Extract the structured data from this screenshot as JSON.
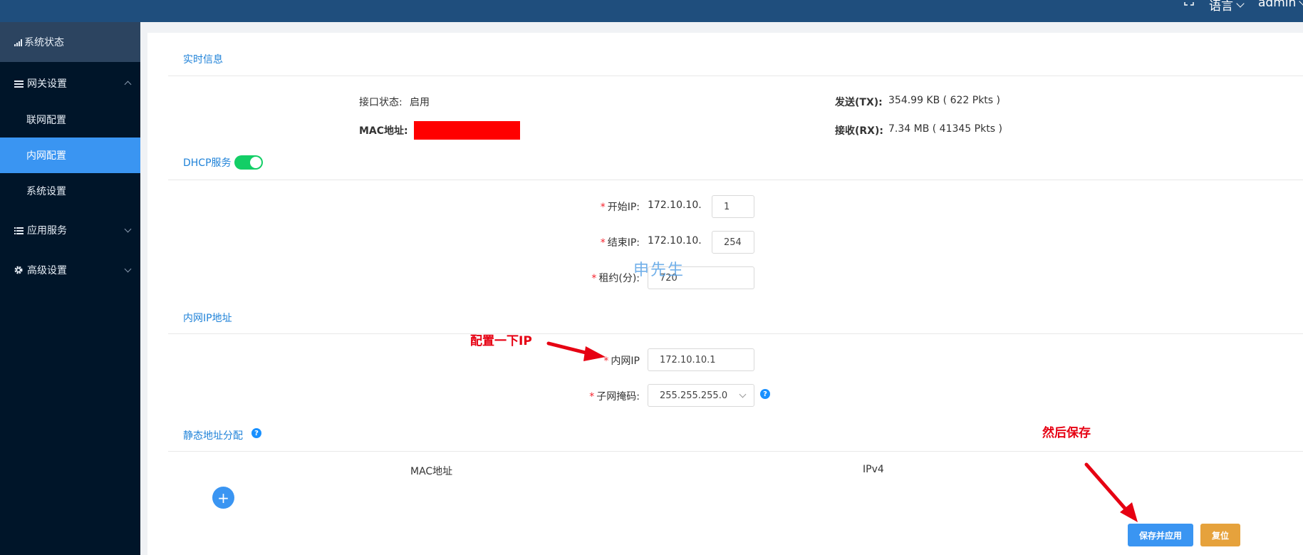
{
  "topbar": {
    "fullscreen_icon": "fullscreen-icon",
    "language": "语言",
    "user": "admin"
  },
  "sidebar": {
    "status": "系统状态",
    "gateway": "网关设置",
    "network": "联网配置",
    "lan": "内网配置",
    "system": "系统设置",
    "apps": "应用服务",
    "advanced": "高级设置"
  },
  "realtime": {
    "title": "实时信息",
    "port_label": "接口状态:",
    "port_value": "启用",
    "mac_label": "MAC地址:",
    "tx_label": "发送(TX):",
    "tx_value": "354.99 KB ( 622 Pkts )",
    "rx_label": "接收(RX):",
    "rx_value": "7.34 MB ( 41345 Pkts )"
  },
  "dhcp": {
    "title": "DHCP服务",
    "enabled": true,
    "start_label": "开始IP:",
    "start_prefix": "172.10.10.",
    "start_value": "1",
    "end_label": "结束IP:",
    "end_prefix": "172.10.10.",
    "end_value": "254",
    "lease_label": "租约(分):",
    "lease_value": "720"
  },
  "lanip": {
    "title": "内网IP地址",
    "ip_label": "内网IP",
    "ip_value": "172.10.10.1",
    "mask_label": "子网掩码:",
    "mask_value": "255.255.255.0"
  },
  "static": {
    "title": "静态地址分配",
    "col_mac": "MAC地址",
    "col_ipv4": "IPv4",
    "add": "+"
  },
  "actions": {
    "save": "保存并应用",
    "reset": "复位"
  },
  "annotations": {
    "configure_ip": "配置一下IP",
    "then_save": "然后保存",
    "watermark": "申先生"
  },
  "colors": {
    "accent": "#3a95f2",
    "sidebar_bg": "#001529",
    "topbar_bg": "#1f4e7d",
    "toggle_on": "#13ce66",
    "reset": "#e6a23c",
    "annotation": "#e60012"
  }
}
